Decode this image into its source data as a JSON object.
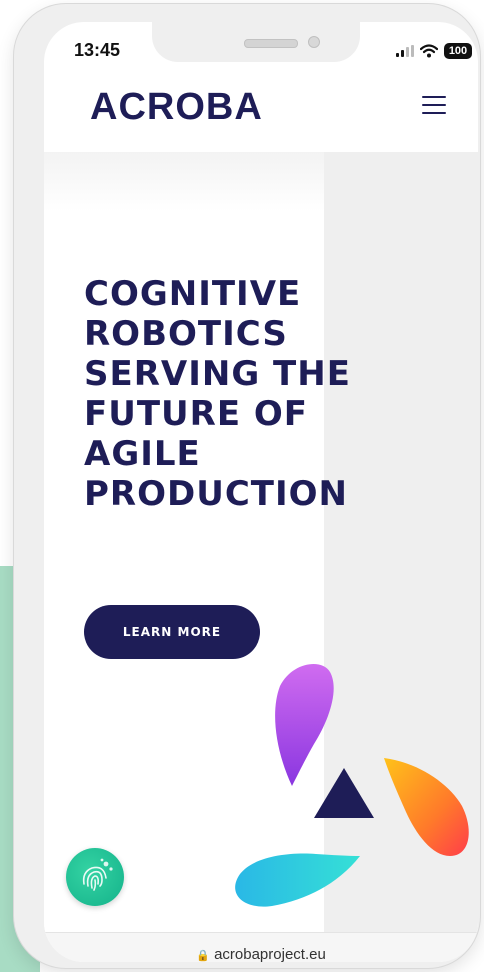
{
  "status_bar": {
    "time": "13:45",
    "battery": "100"
  },
  "header": {
    "logo": "ACROBA"
  },
  "hero": {
    "headline_lines": [
      "COGNITIVE",
      "ROBOTICS",
      "SERVING THE",
      "FUTURE OF",
      "AGILE",
      "PRODUCTION"
    ],
    "cta_label": "LEARN MORE"
  },
  "footer": {
    "url": "acrobaproject.eu"
  },
  "colors": {
    "brand_navy": "#1e1d57",
    "accent_mint": "#a8dcc4",
    "fab_green": "#1dbf92"
  },
  "icons": [
    "signal-icon",
    "wifi-icon",
    "battery-icon",
    "menu-icon",
    "fingerprint-icon",
    "lock-icon"
  ]
}
